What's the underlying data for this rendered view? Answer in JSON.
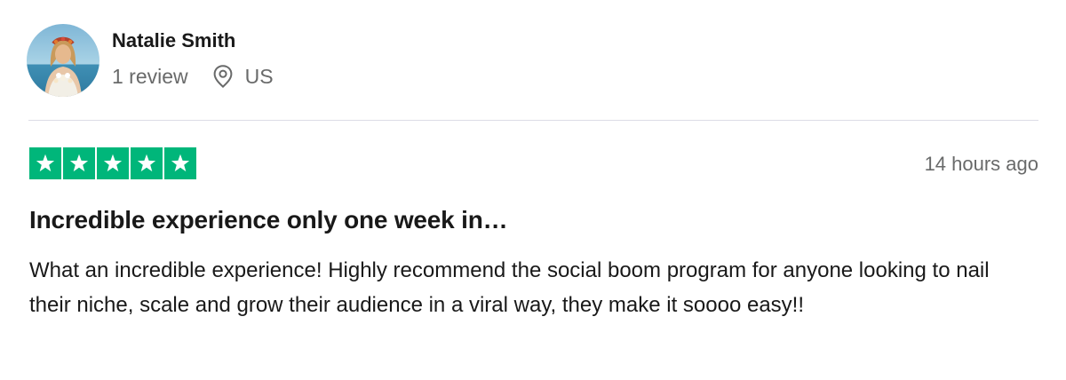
{
  "reviewer": {
    "name": "Natalie Smith",
    "review_count": "1 review",
    "location": "US",
    "avatar_icon": "profile-photo",
    "location_icon": "map-pin-icon"
  },
  "review": {
    "rating": 5,
    "rating_max": 5,
    "star_color": "#00b67a",
    "date": "14 hours ago",
    "title": "Incredible experience only one week in…",
    "body": "What an incredible experience! Highly recommend the social boom program for anyone looking to nail their niche, scale and grow their audience in a viral way, they make it soooo easy!!"
  }
}
